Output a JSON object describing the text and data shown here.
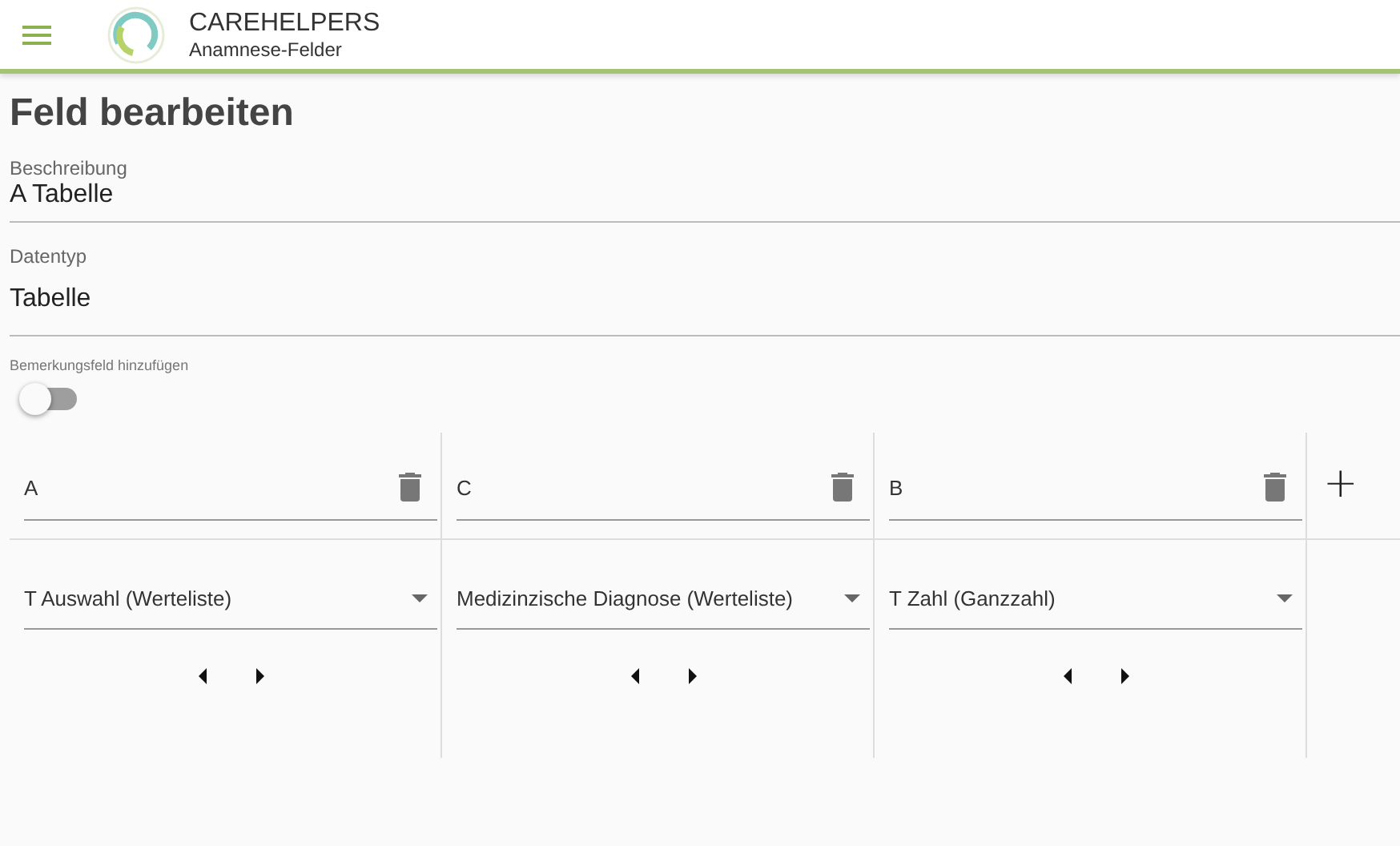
{
  "app_bar": {
    "title": "CAREHELPERS",
    "subtitle": "Anamnese-Felder"
  },
  "page_title": "Feld bearbeiten",
  "fields": [
    {
      "label": "Beschreibung",
      "value": "A Tabelle"
    },
    {
      "label": "Datentyp",
      "value": "Tabelle"
    }
  ],
  "remark_toggle": {
    "label": "Bemerkungsfeld hinzufügen",
    "on": false
  },
  "table_columns": [
    {
      "name": "A",
      "type": "T Auswahl (Werteliste)"
    },
    {
      "name": "C",
      "type": "Medizinzische Diagnose (Werteliste)"
    },
    {
      "name": "B",
      "type": "T Zahl (Ganzzahl)"
    }
  ],
  "add_column": {
    "label": "+"
  }
}
